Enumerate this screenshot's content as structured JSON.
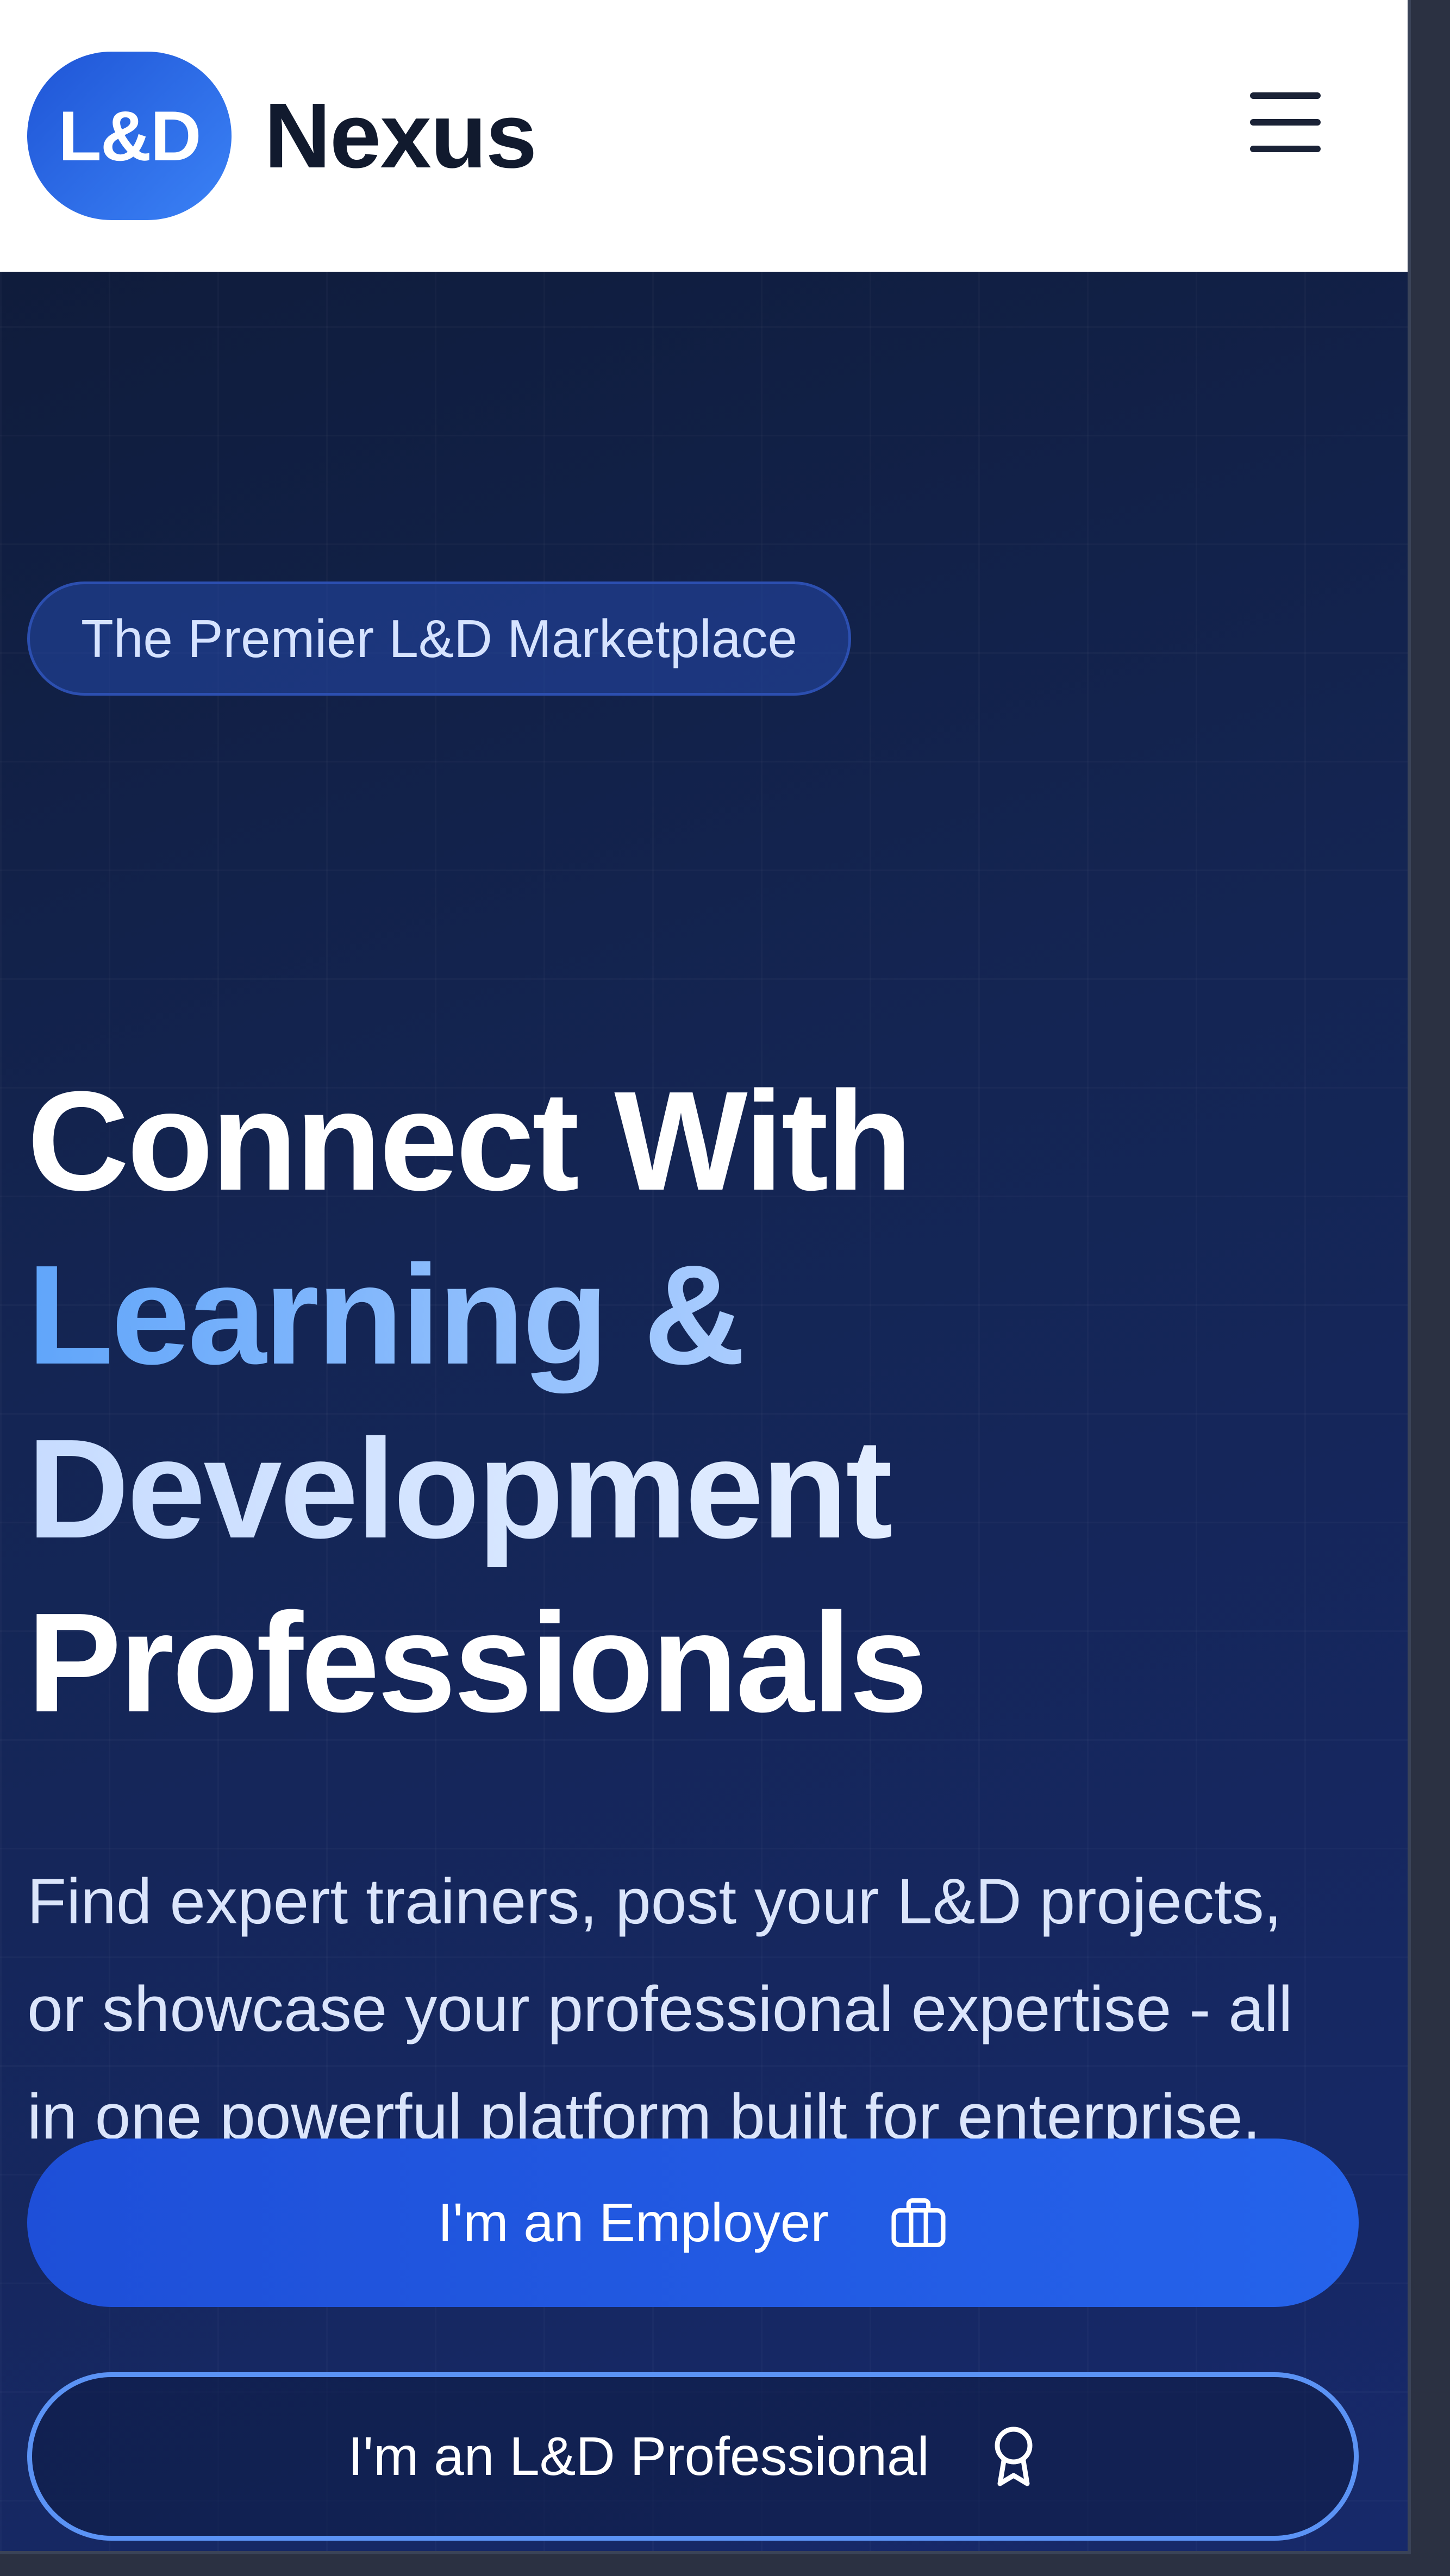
{
  "header": {
    "logo_text": "L&D",
    "brand_name": "Nexus",
    "menu_icon": "hamburger-menu-icon"
  },
  "hero": {
    "badge": "The Premier L&D Marketplace",
    "headline": {
      "line1": "Connect With",
      "line2": "Learning &",
      "line3": "Development",
      "line4": "Professionals"
    },
    "subtext": "Find expert trainers, post your L&D projects, or showcase your professional expertise - all in one powerful platform built for enterprise.",
    "primary_cta": {
      "label": "I'm an Employer",
      "icon": "briefcase-icon"
    },
    "secondary_cta": {
      "label": "I'm an L&D Professional",
      "icon": "award-ribbon-icon"
    }
  },
  "colors": {
    "brand_blue": "#2563eb",
    "hero_bg": "#142553",
    "accent_light_blue": "#60a5fa"
  }
}
